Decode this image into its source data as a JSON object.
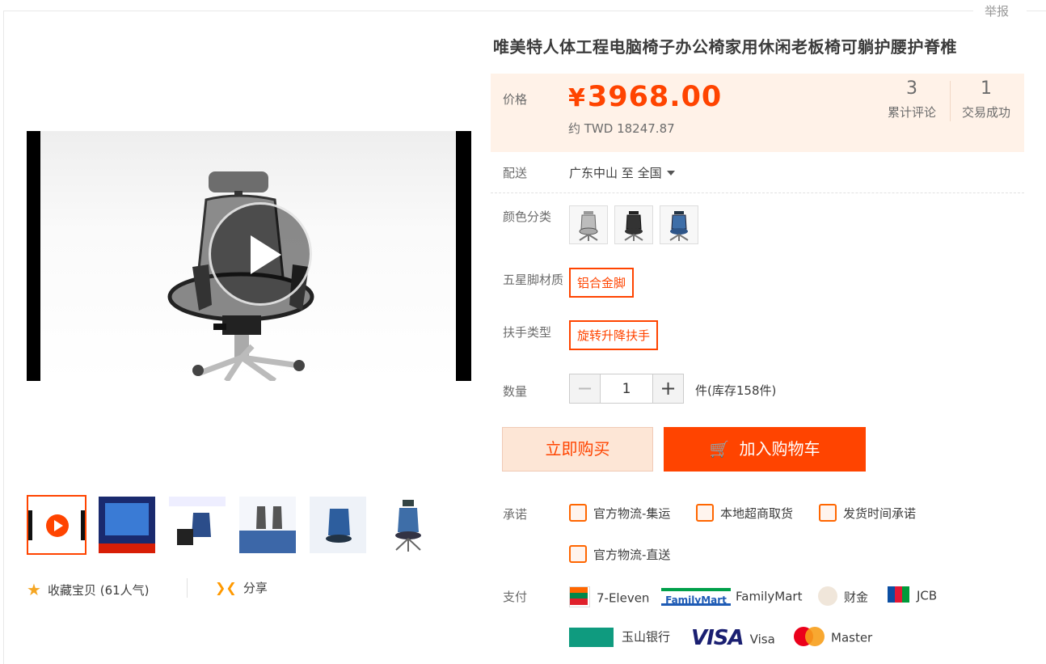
{
  "report_label": "举报",
  "product": {
    "title": "唯美特人体工程电脑椅子办公椅家用休闲老板椅可躺护腰护脊椎"
  },
  "price": {
    "label": "价格",
    "currency_symbol": "¥",
    "amount": "3968.00",
    "approx_twd": "约 TWD 18247.87"
  },
  "stats": {
    "reviews_count": "3",
    "reviews_label": "累计评论",
    "deals_count": "1",
    "deals_label": "交易成功"
  },
  "shipping": {
    "label": "配送",
    "origin": "广东中山",
    "to": "至",
    "destination": "全国"
  },
  "color": {
    "label": "颜色分类",
    "swatches": [
      "gray-chair",
      "black-chair",
      "blue-chair"
    ]
  },
  "base_material": {
    "label": "五星脚材质",
    "selected": "铝合金脚"
  },
  "armrest": {
    "label": "扶手类型",
    "selected": "旋转升降扶手"
  },
  "quantity": {
    "label": "数量",
    "minus": "−",
    "value": "1",
    "plus": "+",
    "stock_text": "件(库存158件)"
  },
  "actions": {
    "buy_now": "立即购买",
    "add_to_cart": "加入购物车"
  },
  "promise": {
    "label": "承诺",
    "items": [
      "官方物流-集运",
      "本地超商取货",
      "发货时间承诺",
      "官方物流-直送"
    ]
  },
  "payment": {
    "label": "支付",
    "methods": [
      "7-Eleven",
      "FamilyMart",
      "财金",
      "JCB",
      "玉山银行",
      "Visa",
      "Master"
    ],
    "familymart_logo_text": "FamilyMart",
    "visa_logo_text": "VISA"
  },
  "gallery": {
    "favorite_label": "收藏宝贝",
    "popularity": "(61人气)",
    "share_label": "分享"
  },
  "colors": {
    "accent": "#ff4400",
    "price_bg": "#fff2e8",
    "buy_now_bg": "#fde6d6"
  }
}
